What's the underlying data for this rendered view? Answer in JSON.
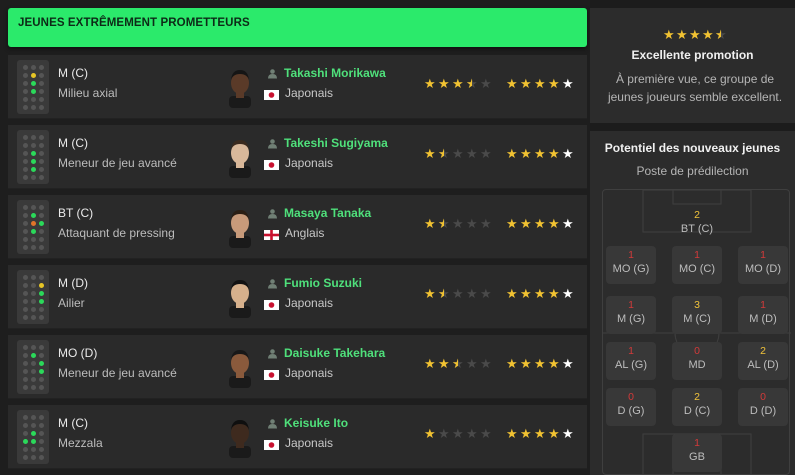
{
  "header": {
    "title": "JEUNES EXTRÊMEMENT PROMETTEURS"
  },
  "players": [
    {
      "position": "M (C)",
      "role": "Milieu axial",
      "name": "Takashi Morikawa",
      "nationality": "Japonais",
      "flag": "japan",
      "current_ability_stars": 3.5,
      "potential_stars": 5,
      "mini_pitch": [
        {
          "r": 1,
          "c": 1,
          "color": "yellow"
        },
        {
          "r": 2,
          "c": 1,
          "color": "green"
        },
        {
          "r": 3,
          "c": 1,
          "color": "green"
        }
      ]
    },
    {
      "position": "M (C)",
      "role": "Meneur de jeu avancé",
      "name": "Takeshi Sugiyama",
      "nationality": "Japonais",
      "flag": "japan",
      "current_ability_stars": 1.5,
      "potential_stars": 5,
      "mini_pitch": [
        {
          "r": 2,
          "c": 1,
          "color": "green"
        },
        {
          "r": 3,
          "c": 1,
          "color": "green"
        },
        {
          "r": 4,
          "c": 1,
          "color": "green"
        }
      ]
    },
    {
      "position": "BT (C)",
      "role": "Attaquant de pressing",
      "name": "Masaya Tanaka",
      "nationality": "Anglais",
      "flag": "england",
      "current_ability_stars": 1.5,
      "potential_stars": 5,
      "mini_pitch": [
        {
          "r": 1,
          "c": 1,
          "color": "green"
        },
        {
          "r": 2,
          "c": 1,
          "color": "orange"
        },
        {
          "r": 2,
          "c": 2,
          "color": "green"
        },
        {
          "r": 3,
          "c": 1,
          "color": "green"
        }
      ]
    },
    {
      "position": "M (D)",
      "role": "Ailier",
      "name": "Fumio Suzuki",
      "nationality": "Japonais",
      "flag": "japan",
      "current_ability_stars": 1.5,
      "potential_stars": 5,
      "mini_pitch": [
        {
          "r": 1,
          "c": 2,
          "color": "yellow"
        },
        {
          "r": 2,
          "c": 2,
          "color": "green"
        },
        {
          "r": 3,
          "c": 2,
          "color": "green"
        }
      ]
    },
    {
      "position": "MO (D)",
      "role": "Meneur de jeu avancé",
      "name": "Daisuke Takehara",
      "nationality": "Japonais",
      "flag": "japan",
      "current_ability_stars": 2.5,
      "potential_stars": 5,
      "mini_pitch": [
        {
          "r": 1,
          "c": 1,
          "color": "green"
        },
        {
          "r": 2,
          "c": 2,
          "color": "green"
        },
        {
          "r": 3,
          "c": 2,
          "color": "green"
        }
      ]
    },
    {
      "position": "M (C)",
      "role": "Mezzala",
      "name": "Keisuke Ito",
      "nationality": "Japonais",
      "flag": "japan",
      "current_ability_stars": 1,
      "potential_stars": 5,
      "mini_pitch": [
        {
          "r": 2,
          "c": 1,
          "color": "green"
        },
        {
          "r": 3,
          "c": 0,
          "color": "green"
        },
        {
          "r": 3,
          "c": 1,
          "color": "green"
        }
      ]
    }
  ],
  "promotion": {
    "stars": 4.5,
    "title": "Excellente promotion",
    "description": "À première vue, ce groupe de jeunes joueurs semble excellent."
  },
  "potential": {
    "title": "Potentiel des nouveaux jeunes",
    "subtitle": "Poste de prédilection",
    "cells": {
      "bt_c": {
        "count": "2",
        "label": "BT (C)",
        "color": "yellow"
      },
      "mo_g": {
        "count": "1",
        "label": "MO (G)",
        "color": "red"
      },
      "mo_c": {
        "count": "1",
        "label": "MO (C)",
        "color": "red"
      },
      "mo_d": {
        "count": "1",
        "label": "MO (D)",
        "color": "red"
      },
      "m_g": {
        "count": "1",
        "label": "M (G)",
        "color": "red"
      },
      "m_c": {
        "count": "3",
        "label": "M (C)",
        "color": "yellow"
      },
      "m_d": {
        "count": "1",
        "label": "M (D)",
        "color": "red"
      },
      "al_g": {
        "count": "1",
        "label": "AL (G)",
        "color": "red"
      },
      "md": {
        "count": "0",
        "label": "MD",
        "color": "red"
      },
      "al_d": {
        "count": "2",
        "label": "AL (D)",
        "color": "yellow"
      },
      "d_g": {
        "count": "0",
        "label": "D (G)",
        "color": "red"
      },
      "d_c": {
        "count": "2",
        "label": "D (C)",
        "color": "yellow"
      },
      "d_d": {
        "count": "0",
        "label": "D (D)",
        "color": "red"
      },
      "gb": {
        "count": "1",
        "label": "GB",
        "color": "red"
      }
    }
  },
  "colors": {
    "accent": "#2bea6b",
    "name": "#4fe07b",
    "star": "#f1c232"
  }
}
